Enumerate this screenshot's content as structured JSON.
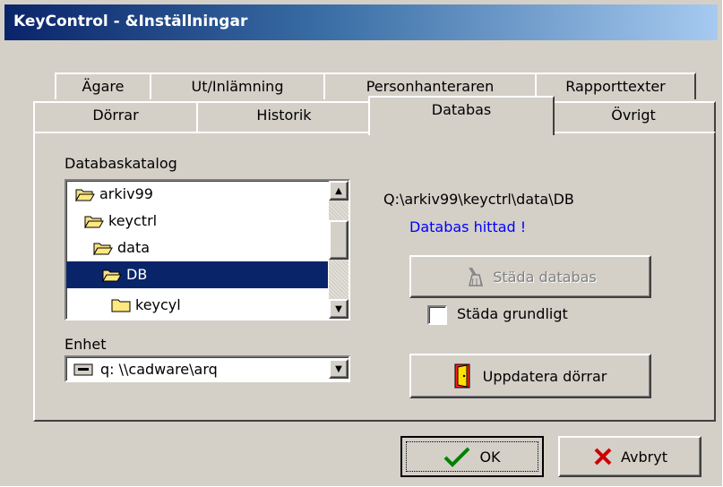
{
  "window": {
    "title": "KeyControl - &Inställningar"
  },
  "tabs_row_back": [
    {
      "label": "Ägare"
    },
    {
      "label": "Ut/Inlämning"
    },
    {
      "label": "Personhanteraren"
    },
    {
      "label": "Rapporttexter"
    }
  ],
  "tabs_row_front": [
    {
      "label": "Dörrar"
    },
    {
      "label": "Historik"
    },
    {
      "label": "Databas",
      "selected": true
    },
    {
      "label": "Övrigt"
    }
  ],
  "databas": {
    "catalog_label": "Databaskatalog",
    "folders": [
      {
        "name": "arkiv99",
        "icon": "folder-open-icon"
      },
      {
        "name": "keyctrl",
        "icon": "folder-open-icon"
      },
      {
        "name": "data",
        "icon": "folder-open-icon"
      },
      {
        "name": "DB",
        "icon": "folder-open-icon",
        "selected": true
      },
      {
        "name": "keycyl",
        "icon": "folder-closed-icon"
      }
    ],
    "unit_label": "Enhet",
    "unit_value": "q: \\\\cadware\\arq",
    "path": "Q:\\arkiv99\\keyctrl\\data\\DB",
    "status": "Databas hittad !",
    "status_color": "#0000ff",
    "clean_button": "Städa databas",
    "clean_thorough_label": "Städa grundligt",
    "update_doors_button": "Uppdatera dörrar"
  },
  "footer": {
    "ok_label": "OK",
    "cancel_label": "Avbryt"
  },
  "colors": {
    "face": "#d4d0c8",
    "selection": "#0a246a",
    "title_start": "#0a246a",
    "title_end": "#a6caf0"
  }
}
